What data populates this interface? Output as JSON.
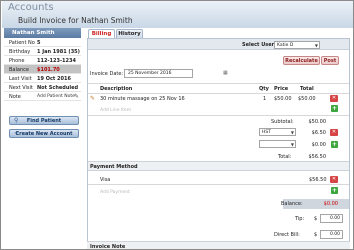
{
  "app": {
    "title": "Accounts",
    "page_title": "Build Invoice for Nathan Smith"
  },
  "patient": {
    "name": "Nathan Smith",
    "fields": [
      {
        "label": "Patient No",
        "value": "5"
      },
      {
        "label": "Birthday",
        "value": "1 Jan 1981 (35)"
      },
      {
        "label": "Phone",
        "value": "112-123-1234"
      },
      {
        "label": "Balance",
        "value": "$101.70"
      },
      {
        "label": "Last Visit",
        "value": "19 Oct 2016"
      },
      {
        "label": "Next Visit",
        "value": "Not Scheduled"
      },
      {
        "label": "Note",
        "value": "Add Patient Note"
      }
    ],
    "find_button": "Find Patient",
    "create_button": "Create New Account"
  },
  "tabs": [
    {
      "label": "Billing"
    },
    {
      "label": "History"
    }
  ],
  "user_select": {
    "label": "Select User:",
    "value": "Katie D"
  },
  "actions": {
    "recalculate": "Recalculate",
    "post": "Post"
  },
  "invoice": {
    "date_label": "Invoice Date:",
    "date_value": "25 November 2016",
    "columns": {
      "description": "Description",
      "qty": "Qty",
      "price": "Price",
      "total": "Total"
    },
    "items": [
      {
        "description": "30 minute massage on 25 Nov 16",
        "qty": "1",
        "price": "$50.00",
        "total": "$50.00"
      }
    ],
    "add_line_placeholder": "Add Line Item",
    "subtotal_label": "Subtotal:",
    "subtotal_value": "$50.00",
    "tax1_name": "HST",
    "tax1_value": "$6.50",
    "tax2_value": "$0.00",
    "total_label": "Total:",
    "total_value": "$56.50"
  },
  "payment": {
    "section_title": "Payment Method",
    "method": "Visa",
    "amount": "$56.50",
    "add_placeholder": "Add Payment",
    "balance_label": "Balance:",
    "balance_value": "$0.00",
    "tip_label": "Tip:",
    "tip_currency": "$",
    "tip_value": "0.00",
    "direct_bill_label": "Direct Bill:",
    "direct_bill_currency": "$",
    "direct_bill_value": "0.00"
  },
  "invoice_note": {
    "title": "Invoice Note"
  },
  "colors": {
    "accent": "#cc2222",
    "header_blue": "#5a7aa2",
    "add_green": "#3ea63e",
    "delete_red": "#d64545"
  }
}
